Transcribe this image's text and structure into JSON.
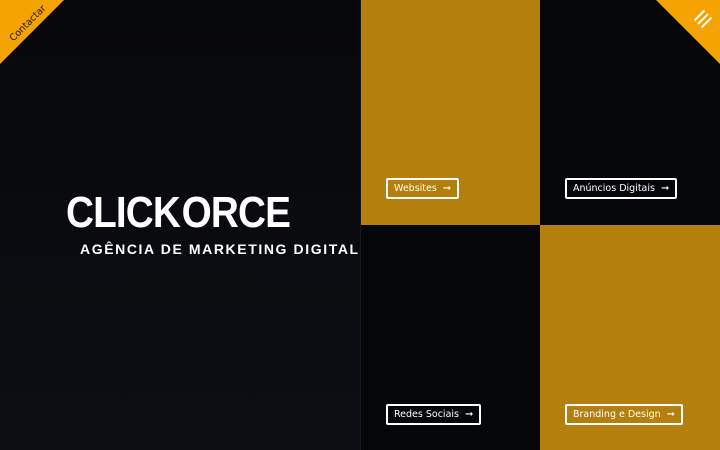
{
  "brand": {
    "logo_left": "CLICK",
    "logo_right": "ORCE",
    "tagline": "AGÊNCIA DE MARKETING DIGITAL",
    "gold": "#b47f0c",
    "accent": "#f5a300"
  },
  "corners": {
    "contact_label": "Contactar",
    "menu_icon": "hamburger-icon"
  },
  "services": [
    {
      "label": "Websites",
      "icon": "arrow-right-icon",
      "tone": "gold"
    },
    {
      "label": "Anúncios Digitais",
      "icon": "arrow-right-icon",
      "tone": "dark"
    },
    {
      "label": "Redes Sociais",
      "icon": "arrow-right-icon",
      "tone": "dark"
    },
    {
      "label": "Branding e Design",
      "icon": "arrow-right-icon",
      "tone": "gold"
    }
  ],
  "arrow_glyph": "➞"
}
